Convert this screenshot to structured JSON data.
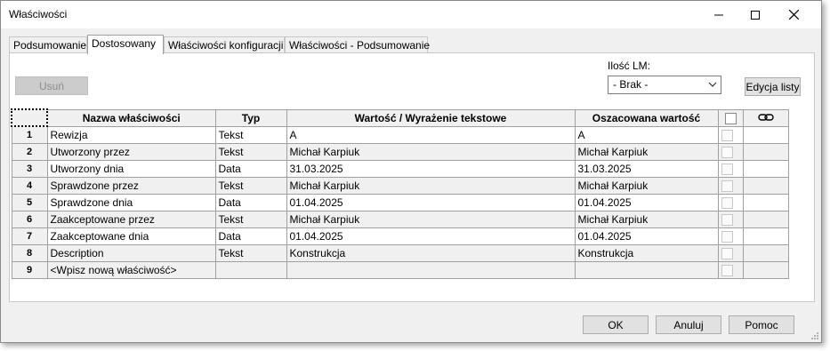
{
  "window": {
    "title": "Właściwości"
  },
  "tabs": [
    "Podsumowanie",
    "Dostosowany",
    "Właściwości konfiguracji",
    "Właściwości - Podsumowanie"
  ],
  "toolbar": {
    "delete_label": "Usuń",
    "lm_label": "Ilość LM:",
    "lm_value": "- Brak -",
    "edit_list_label": "Edycja listy"
  },
  "table": {
    "headers": {
      "name": "Nazwa właściwości",
      "type": "Typ",
      "value": "Wartość / Wyrażenie tekstowe",
      "evaluated": "Oszacowana wartość"
    },
    "rows": [
      {
        "num": "1",
        "name": "Rewizja",
        "type": "Tekst",
        "value": "A",
        "evaluated": "A"
      },
      {
        "num": "2",
        "name": "Utworzony przez",
        "type": "Tekst",
        "value": "Michał Karpiuk",
        "evaluated": "Michał Karpiuk"
      },
      {
        "num": "3",
        "name": "Utworzony dnia",
        "type": "Data",
        "value": "31.03.2025",
        "evaluated": "31.03.2025"
      },
      {
        "num": "4",
        "name": "Sprawdzone przez",
        "type": "Tekst",
        "value": "Michał Karpiuk",
        "evaluated": "Michał Karpiuk"
      },
      {
        "num": "5",
        "name": "Sprawdzone dnia",
        "type": "Data",
        "value": "01.04.2025",
        "evaluated": "01.04.2025"
      },
      {
        "num": "6",
        "name": "Zaakceptowane przez",
        "type": "Tekst",
        "value": "Michał Karpiuk",
        "evaluated": "Michał Karpiuk"
      },
      {
        "num": "7",
        "name": "Zaakceptowane dnia",
        "type": "Data",
        "value": "01.04.2025",
        "evaluated": "01.04.2025"
      },
      {
        "num": "8",
        "name": "Description",
        "type": "Tekst",
        "value": "Konstrukcja",
        "evaluated": "Konstrukcja"
      },
      {
        "num": "9",
        "name": "<Wpisz nową właściwość>",
        "type": "",
        "value": "",
        "evaluated": ""
      }
    ]
  },
  "footer": {
    "ok_label": "OK",
    "cancel_label": "Anuluj",
    "help_label": "Pomoc"
  },
  "icons": {
    "minimize": "minimize-icon",
    "maximize": "maximize-icon",
    "close": "close-icon",
    "link": "link-icon",
    "dropdown": "chevron-down-icon"
  }
}
